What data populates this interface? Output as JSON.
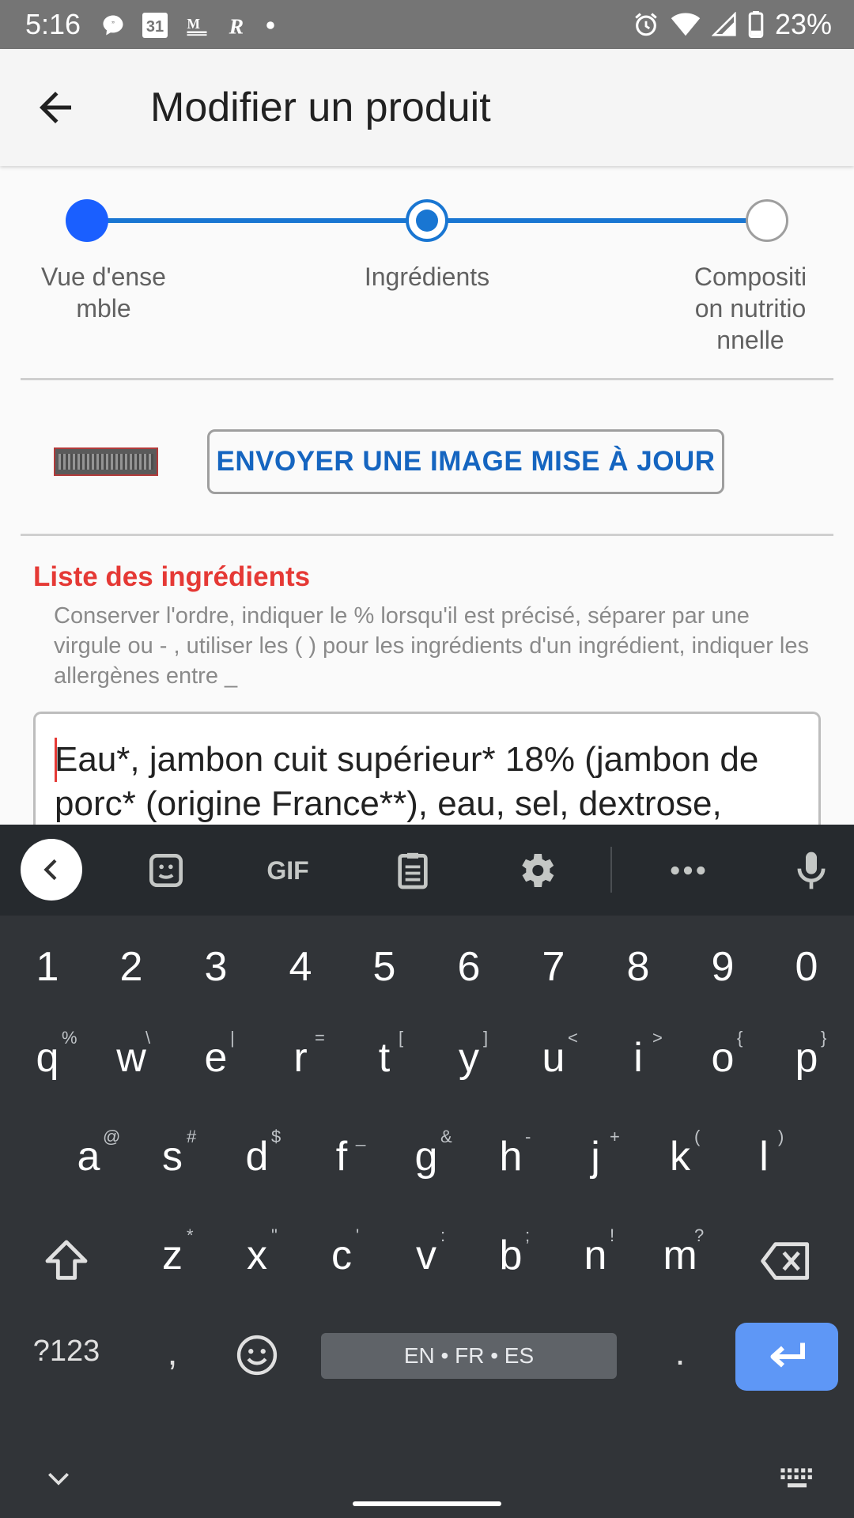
{
  "status_bar": {
    "time": "5:16",
    "calendar_day": "31",
    "battery_percent": "23%",
    "left_icons": [
      "chat-bubble-icon",
      "calendar-icon",
      "gmail-icon",
      "r-app-icon",
      "dot-icon"
    ],
    "right_icons": [
      "alarm-icon",
      "wifi-icon",
      "signal-icon",
      "battery-icon"
    ]
  },
  "app_bar": {
    "title": "Modifier un produit"
  },
  "stepper": {
    "steps": [
      {
        "label": "Vue d'ense\nmble",
        "state": "done"
      },
      {
        "label": "Ingrédients",
        "state": "current"
      },
      {
        "label": "Compositi\non nutritio\nnnelle",
        "state": "upcoming"
      }
    ],
    "accent_color": "#1976d2"
  },
  "image_section": {
    "upload_button_label": "ENVOYER UNE IMAGE MISE À JOUR"
  },
  "ingredients": {
    "title": "Liste des ingrédients",
    "title_color": "#e53935",
    "hint": "Conserver l'ordre, indiquer le % lorsqu'il est précisé, séparer par une virgule ou - , utiliser les ( ) pour les ingrédients d'un ingrédient, indiquer les allergènes entre _",
    "value": "Eau*, jambon cuit supérieur* 18% (jambon de porc* (origine France**), eau, sel, dextrose,"
  },
  "keyboard": {
    "toolbar": [
      "back-chevron-icon",
      "sticker-icon",
      "GIF",
      "clipboard-icon",
      "settings-icon",
      "more-icon",
      "mic-icon"
    ],
    "number_row": [
      "1",
      "2",
      "3",
      "4",
      "5",
      "6",
      "7",
      "8",
      "9",
      "0"
    ],
    "row1": [
      {
        "k": "q",
        "h": "%"
      },
      {
        "k": "w",
        "h": "\\"
      },
      {
        "k": "e",
        "h": "|"
      },
      {
        "k": "r",
        "h": "="
      },
      {
        "k": "t",
        "h": "["
      },
      {
        "k": "y",
        "h": "]"
      },
      {
        "k": "u",
        "h": "<"
      },
      {
        "k": "i",
        "h": ">"
      },
      {
        "k": "o",
        "h": "{"
      },
      {
        "k": "p",
        "h": "}"
      }
    ],
    "row2": [
      {
        "k": "a",
        "h": "@"
      },
      {
        "k": "s",
        "h": "#"
      },
      {
        "k": "d",
        "h": "$"
      },
      {
        "k": "f",
        "h": "_"
      },
      {
        "k": "g",
        "h": "&"
      },
      {
        "k": "h",
        "h": "-"
      },
      {
        "k": "j",
        "h": "+"
      },
      {
        "k": "k",
        "h": "("
      },
      {
        "k": "l",
        "h": ")"
      }
    ],
    "row3": [
      {
        "k": "z",
        "h": "*"
      },
      {
        "k": "x",
        "h": "\""
      },
      {
        "k": "c",
        "h": "'"
      },
      {
        "k": "v",
        "h": ":"
      },
      {
        "k": "b",
        "h": ";"
      },
      {
        "k": "n",
        "h": "!"
      },
      {
        "k": "m",
        "h": "?"
      }
    ],
    "symbols_key": "?123",
    "comma_key": ",",
    "period_key": ".",
    "space_label": "EN • FR • ES",
    "gif_label": "GIF",
    "enter_color": "#5e97f6"
  }
}
